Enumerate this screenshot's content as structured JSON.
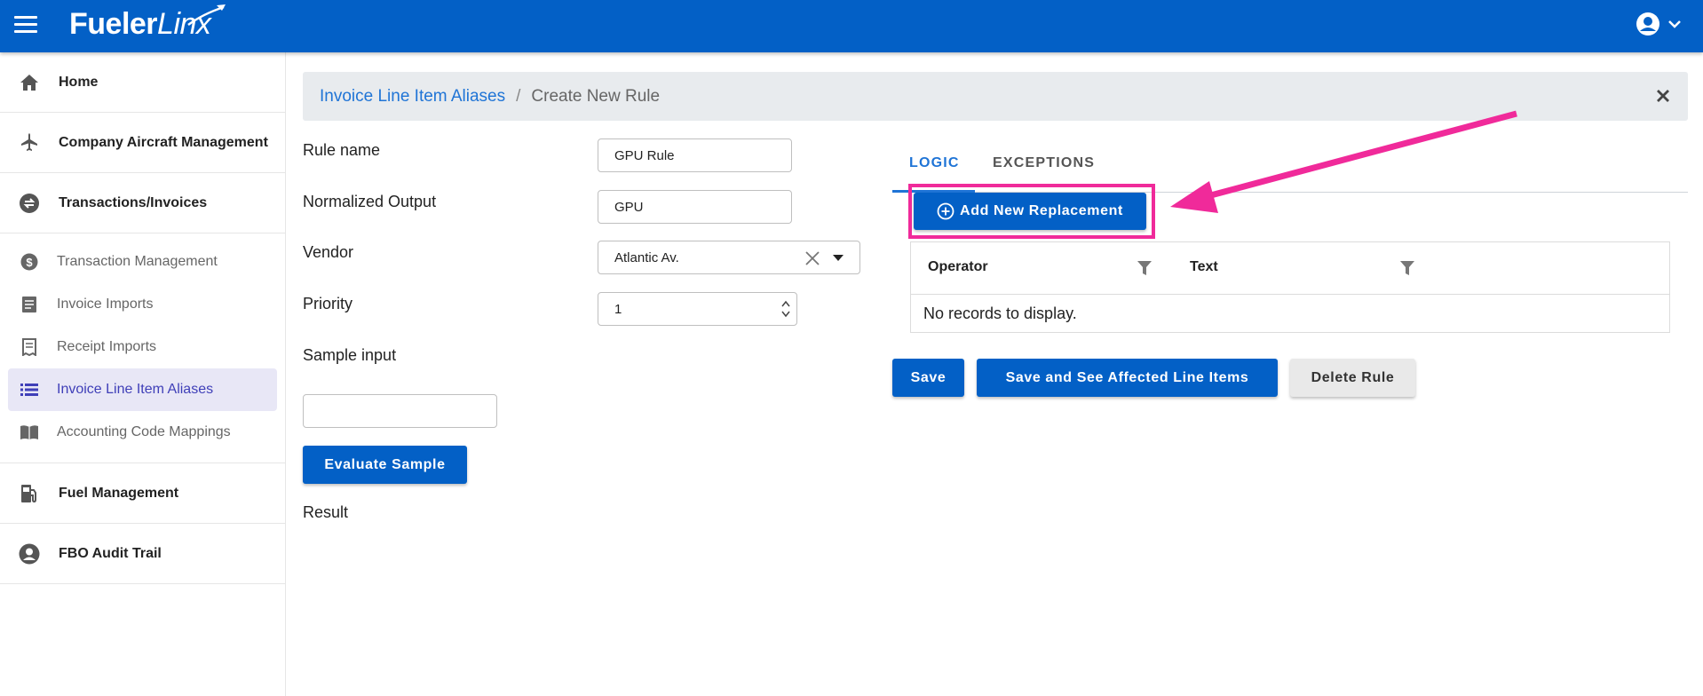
{
  "header": {
    "logo_main": "Fueler",
    "logo_accent": "Linx"
  },
  "sidebar": {
    "items": [
      {
        "label": "Home"
      },
      {
        "label": "Company Aircraft Management"
      },
      {
        "label": "Transactions/Invoices"
      }
    ],
    "sub_items": [
      {
        "label": "Transaction Management"
      },
      {
        "label": "Invoice Imports"
      },
      {
        "label": "Receipt Imports"
      },
      {
        "label": "Invoice Line Item Aliases"
      },
      {
        "label": "Accounting Code Mappings"
      }
    ],
    "items_after": [
      {
        "label": "Fuel Management"
      },
      {
        "label": "FBO Audit Trail"
      }
    ]
  },
  "breadcrumb": {
    "parent": "Invoice Line Item Aliases",
    "separator": "/",
    "current": "Create New Rule"
  },
  "form": {
    "rule_name_label": "Rule name",
    "rule_name_value": "GPU Rule",
    "normalized_output_label": "Normalized Output",
    "normalized_output_value": "GPU",
    "vendor_label": "Vendor",
    "vendor_value": "Atlantic Av.",
    "priority_label": "Priority",
    "priority_value": "1",
    "sample_input_label": "Sample input",
    "sample_input_value": "",
    "evaluate_button": "Evaluate Sample",
    "result_label": "Result"
  },
  "tabs": {
    "logic": "LOGIC",
    "exceptions": "EXCEPTIONS"
  },
  "logic": {
    "add_button": "Add New Replacement",
    "columns": [
      "Operator",
      "Text"
    ],
    "empty_text": "No records to display."
  },
  "actions": {
    "save": "Save",
    "save_affected": "Save and See Affected Line Items",
    "delete": "Delete Rule"
  },
  "colors": {
    "primary": "#0360c6",
    "highlight": "#f02a9a",
    "active_nav_bg": "#e8e7f6"
  }
}
